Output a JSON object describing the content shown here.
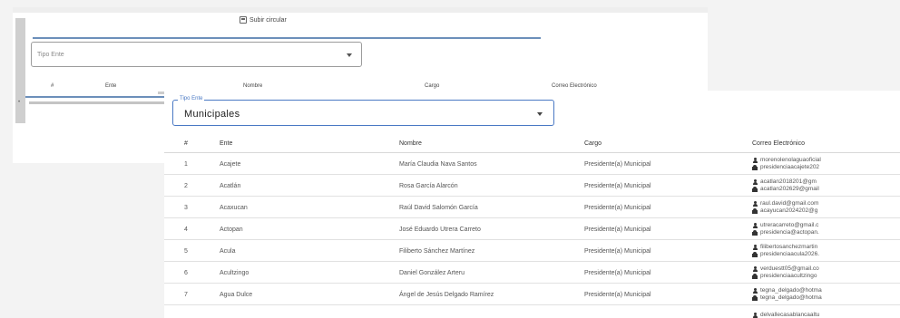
{
  "back_panel": {
    "send_button_label": "Subir circular",
    "tipo_ente_placeholder": "Tipo Ente",
    "columns": [
      "#",
      "Ente",
      "Nombre",
      "Cargo",
      "Correo Electrónico"
    ]
  },
  "filter": {
    "legend": "Tipo Ente",
    "value": "Municipales"
  },
  "table": {
    "columns": {
      "num": "#",
      "ente": "Ente",
      "nombre": "Nombre",
      "cargo": "Cargo",
      "correo": "Correo Electrónico"
    },
    "rows": [
      {
        "num": "1",
        "ente": "Acajete",
        "nombre": "María Claudia Nava Santos",
        "cargo": "Presidente(a) Municipal",
        "email1": "morenolenolaguaoficial",
        "email2": "presidenciaacajete202"
      },
      {
        "num": "2",
        "ente": "Acatlán",
        "nombre": "Rosa García Alarcón",
        "cargo": "Presidente(a) Municipal",
        "email1": "acatlan2018201@gm",
        "email2": "acatlan202629@gmail"
      },
      {
        "num": "3",
        "ente": "Acaxucan",
        "nombre": "Raúl David Salomón García",
        "cargo": "Presidente(a) Municipal",
        "email1": "raul.david@gmail.com",
        "email2": "acayucan2024202@g"
      },
      {
        "num": "4",
        "ente": "Actopan",
        "nombre": "José Eduardo Utrera Carreto",
        "cargo": "Presidente(a) Municipal",
        "email1": "utreracarreto@gmail.c",
        "email2": "presidencia@actopan."
      },
      {
        "num": "5",
        "ente": "Acula",
        "nombre": "Filiberto Sánchez Martínez",
        "cargo": "Presidente(a) Municipal",
        "email1": "filibertosanchezmartin",
        "email2": "presidenciaacula2026."
      },
      {
        "num": "6",
        "ente": "Acultzingo",
        "nombre": "Daniel González Arteru",
        "cargo": "Presidente(a) Municipal",
        "email1": "verduestt05@gmail.co",
        "email2": "presidenciaacultzingo"
      },
      {
        "num": "7",
        "ente": "Agua Dulce",
        "nombre": "Ángel de Jesús Delgado Ramírez",
        "cargo": "Presidente(a) Municipal",
        "email1": "tegna_delgado@hotma",
        "email2": "tegna_delgado@hotma"
      }
    ],
    "partial_email": "delvallecasablancaaltu"
  }
}
